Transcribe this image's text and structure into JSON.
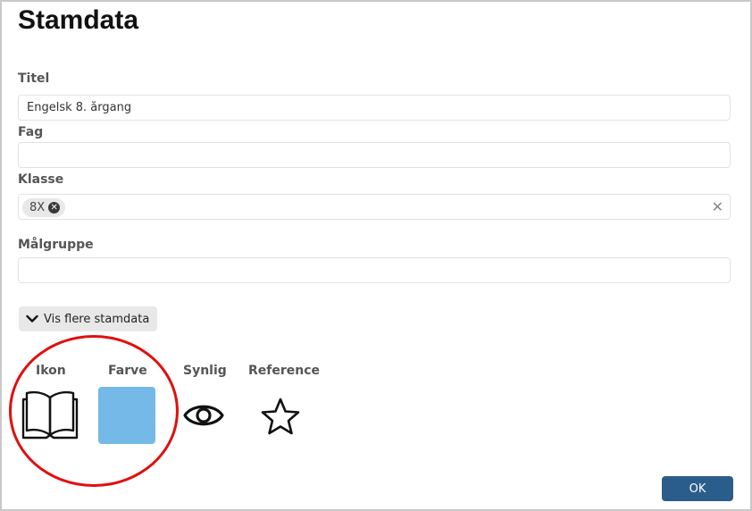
{
  "page": {
    "title": "Stamdata"
  },
  "fields": {
    "titel": {
      "label": "Titel",
      "value": "Engelsk 8. årgang",
      "placeholder": ""
    },
    "fag": {
      "label": "Fag",
      "value": "",
      "placeholder": ""
    },
    "klasse": {
      "label": "Klasse",
      "chips": [
        "8X"
      ],
      "clear_symbol": "✕"
    },
    "malgruppe": {
      "label": "Målgruppe",
      "value": "",
      "placeholder": ""
    }
  },
  "more_button": {
    "label": "Vis flere stamdata",
    "icon": "chevron-down-icon"
  },
  "properties": {
    "ikon": {
      "label": "Ikon",
      "icon": "open-book-icon"
    },
    "farve": {
      "label": "Farve",
      "color": "#74b9e7"
    },
    "synlig": {
      "label": "Synlig",
      "icon": "eye-icon"
    },
    "reference": {
      "label": "Reference",
      "icon": "star-outline-icon"
    }
  },
  "footer": {
    "ok_label": "OK",
    "ok_color": "#2b5d8c"
  },
  "annotation": {
    "color": "#e01010"
  }
}
